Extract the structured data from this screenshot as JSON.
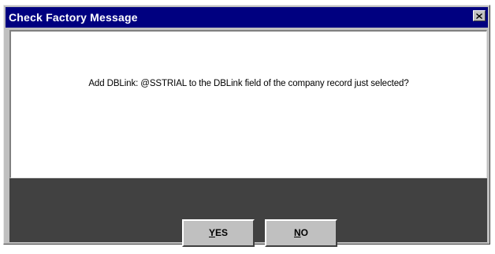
{
  "window": {
    "title": "Check Factory Message"
  },
  "message": {
    "text": "Add DBLink: @SSTRIAL to the DBLink field of the company record just selected?"
  },
  "buttons": {
    "yes": {
      "mnemonic": "Y",
      "rest": "ES"
    },
    "no": {
      "mnemonic": "N",
      "rest": "O"
    }
  },
  "colors": {
    "titlebar": "#000080",
    "dialog_face": "#c0c0c0",
    "button_area": "#414141",
    "message_background": "#ffffff"
  },
  "icons": {
    "close": "close-icon"
  }
}
